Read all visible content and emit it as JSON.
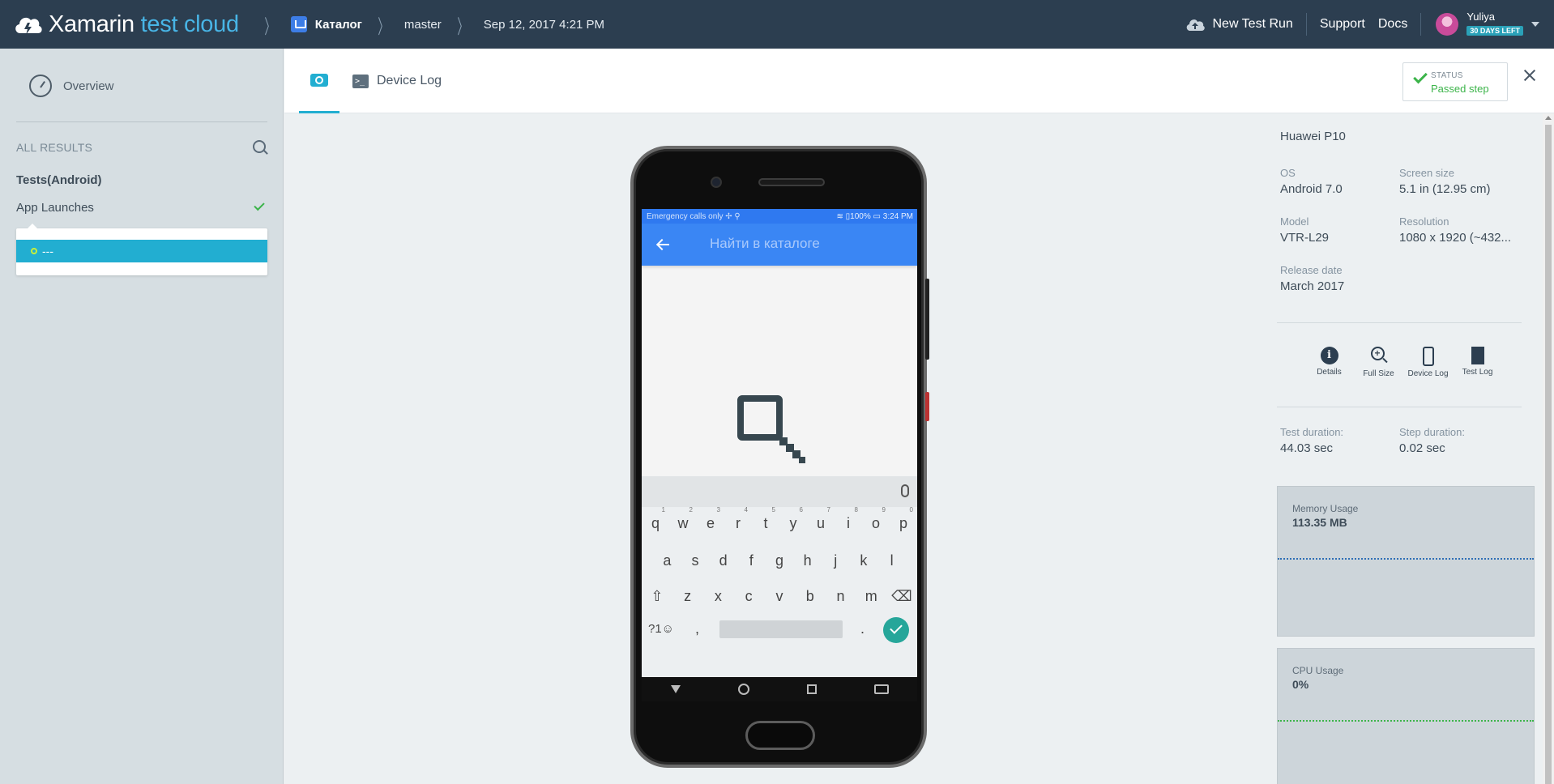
{
  "header": {
    "logo_brand": "Xamarin",
    "logo_product": "test cloud",
    "app_name": "Каталог",
    "branch": "master",
    "run_date": "Sep 12, 2017 4:21 PM",
    "new_test_run": "New Test Run",
    "support": "Support",
    "docs": "Docs",
    "user_name": "Yuliya",
    "trial_badge": "30 DAYS LEFT"
  },
  "sidebar": {
    "overview": "Overview",
    "all_results": "ALL RESULTS",
    "group_title": "Tests(Android)",
    "test_name": "App Launches",
    "step_label": "---"
  },
  "tabs": {
    "device_log": "Device Log"
  },
  "status": {
    "label": "STATUS",
    "value": "Passed step"
  },
  "device_screen": {
    "statusbar_left": "Emergency calls only ✢ ⚲",
    "statusbar_right": "≋ ▯100% ▭ 3:24 PM",
    "search_hint": "Найти в каталоге",
    "keyboard": {
      "row1": [
        "q",
        "w",
        "e",
        "r",
        "t",
        "y",
        "u",
        "i",
        "o",
        "p"
      ],
      "row1_digits": [
        "1",
        "2",
        "3",
        "4",
        "5",
        "6",
        "7",
        "8",
        "9",
        "0"
      ],
      "row2": [
        "a",
        "s",
        "d",
        "f",
        "g",
        "h",
        "j",
        "k",
        "l"
      ],
      "row3": [
        "⇧",
        "z",
        "x",
        "c",
        "v",
        "b",
        "n",
        "m",
        "⌫"
      ],
      "sym": "?1☺",
      "comma": ",",
      "period": "."
    }
  },
  "device_info": {
    "name": "Huawei P10",
    "os_label": "OS",
    "os_value": "Android 7.0",
    "screen_label": "Screen size",
    "screen_value": "5.1 in (12.95 cm)",
    "model_label": "Model",
    "model_value": "VTR-L29",
    "resolution_label": "Resolution",
    "resolution_value": "1080 x 1920 (~432...",
    "release_label": "Release date",
    "release_value": "March 2017"
  },
  "actions": {
    "details": "Details",
    "full_size": "Full Size",
    "device_log": "Device Log",
    "test_log": "Test Log"
  },
  "durations": {
    "test_label": "Test duration:",
    "test_value": "44.03 sec",
    "step_label": "Step duration:",
    "step_value": "0.02 sec"
  },
  "memory": {
    "label": "Memory Usage",
    "value": "113.35 MB",
    "line_color": "#2f6fb5"
  },
  "cpu": {
    "label": "CPU Usage",
    "value": "0%",
    "line_color": "#3cb44a"
  },
  "colors": {
    "topbar": "#2c3e50",
    "accent": "#22aed1",
    "success": "#3cb44a"
  }
}
